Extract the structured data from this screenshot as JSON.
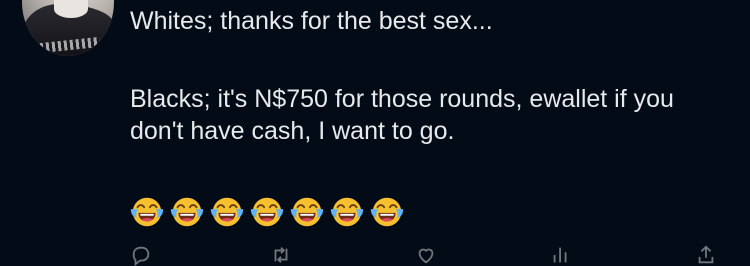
{
  "post": {
    "line1": "Whites; thanks for the best sex...",
    "line2": "Blacks; it's N$750 for those rounds, ewallet if you don't have cash, I want to go.",
    "emoji_count": 7,
    "emoji_name": "face-with-tears-of-joy"
  },
  "actions": {
    "reply_icon": "reply-icon",
    "repost_icon": "repost-icon",
    "like_icon": "heart-icon",
    "views_icon": "views-icon",
    "share_icon": "share-icon"
  },
  "colors": {
    "background": "#030b17",
    "text": "#e7e9ea",
    "muted": "#71767b",
    "emoji_yellow": "#f7c02e"
  }
}
